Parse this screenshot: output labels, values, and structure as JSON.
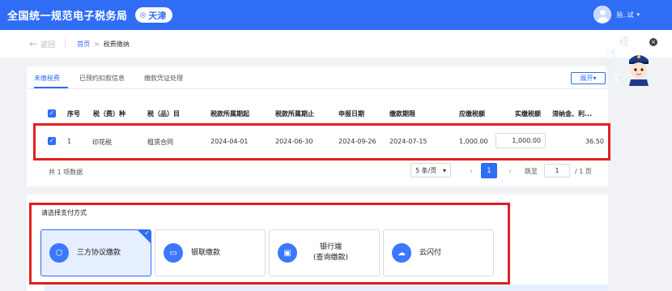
{
  "header": {
    "site_title": "全国统一规范电子税务局",
    "region": "天津",
    "user_name": "验..试",
    "brand_color": "#2f6df5"
  },
  "subnav": {
    "back_label": "返回",
    "breadcrumb_home": "首页",
    "breadcrumb_separator": ">",
    "breadcrumb_current": "税费缴纳"
  },
  "tabs": {
    "items": [
      {
        "label": "未缴税费",
        "active": true
      },
      {
        "label": "已预约扣款信息",
        "active": false
      },
      {
        "label": "缴款凭证处理",
        "active": false
      }
    ],
    "expand_label": "展开"
  },
  "table": {
    "columns": [
      "序号",
      "税（费）种",
      "税（品）目",
      "税款所属期起",
      "税款所属期止",
      "申报日期",
      "缴款期限",
      "应缴税额",
      "实缴税额",
      "滞纳金、利..."
    ],
    "rows": [
      {
        "checked": true,
        "index": "1",
        "tax_type": "印花税",
        "tax_item": "租赁合同",
        "period_start": "2024-04-01",
        "period_end": "2024-06-30",
        "declare_date": "2024-09-26",
        "deadline": "2024-07-15",
        "payable": "1,000.00",
        "paid": "1,000.00",
        "late_fee": "36.50"
      }
    ],
    "total_text": "共 1 项数据"
  },
  "pagination": {
    "page_size": "5 条/页",
    "prev_icon": "‹",
    "current_page": "1",
    "next_icon": "›",
    "jump_label": "跳至",
    "jump_value": "1",
    "total_pages": "/ 1 页"
  },
  "payment": {
    "label": "请选择支付方式",
    "options": [
      {
        "label": "三方协议缴款",
        "icon": "cube-icon",
        "selected": true
      },
      {
        "label": "银联缴款",
        "icon": "card-icon",
        "selected": false
      },
      {
        "label": "银行端\n(查询缴款)",
        "icon": "wallet-icon",
        "selected": false
      },
      {
        "label": "云闪付",
        "icon": "cloud-icon",
        "selected": false
      }
    ]
  },
  "mascot": {
    "chars": [
      "征",
      "纳",
      "互",
      "动"
    ],
    "close_icon": "×"
  }
}
